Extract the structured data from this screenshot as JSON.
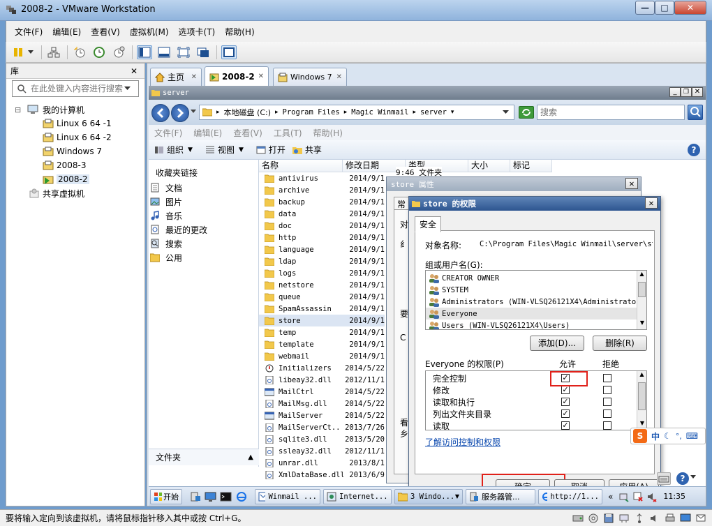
{
  "window": {
    "title": "2008-2 - VMware Workstation",
    "min": "—",
    "max": "□",
    "close": "✕"
  },
  "menu": [
    "文件(F)",
    "编辑(E)",
    "查看(V)",
    "虚拟机(M)",
    "选项卡(T)",
    "帮助(H)"
  ],
  "library": {
    "title": "库",
    "close": "✕",
    "search_placeholder": "在此处键入内容进行搜索",
    "tree": [
      {
        "label": "我的计算机",
        "level": 0,
        "expander": "⊟"
      },
      {
        "label": "Linux 6 64 -1",
        "level": 1
      },
      {
        "label": "Linux 6 64 -2",
        "level": 1
      },
      {
        "label": "Windows 7",
        "level": 1
      },
      {
        "label": "2008-3",
        "level": 1
      },
      {
        "label": "2008-2",
        "level": 1,
        "selected": true
      },
      {
        "label": "共享虚拟机",
        "level": 0,
        "shared": true
      }
    ]
  },
  "tabs": [
    {
      "label": "主页",
      "icon": "home-icon"
    },
    {
      "label": "2008-2",
      "icon": "vm-icon",
      "active": true
    },
    {
      "label": "Windows 7",
      "icon": "vm-icon"
    }
  ],
  "tab_close": "✕",
  "explorer": {
    "title": "server",
    "address": [
      "本地磁盘 (C:)",
      "Program Files",
      "Magic Winmail",
      "server"
    ],
    "search_placeholder": "搜索",
    "menu": [
      "文件(F)",
      "编辑(E)",
      "查看(V)",
      "工具(T)",
      "帮助(H)"
    ],
    "commands": [
      "组织",
      "视图",
      "打开",
      "共享"
    ],
    "nav_title": "收藏夹链接",
    "nav": [
      "文档",
      "图片",
      "音乐",
      "最近的更改",
      "搜索",
      "公用"
    ],
    "folders_label": "文件夹",
    "columns": [
      "名称",
      "修改日期",
      "类型",
      "大小",
      "标记"
    ],
    "files": [
      {
        "name": "antivirus",
        "date": "2014/9/1",
        "type": "folder",
        "extra": "9:46  文件夹"
      },
      {
        "name": "archive",
        "date": "2014/9/1",
        "type": "folder"
      },
      {
        "name": "backup",
        "date": "2014/9/1",
        "type": "folder"
      },
      {
        "name": "data",
        "date": "2014/9/1",
        "type": "folder"
      },
      {
        "name": "doc",
        "date": "2014/9/1",
        "type": "folder"
      },
      {
        "name": "http",
        "date": "2014/9/1",
        "type": "folder"
      },
      {
        "name": "language",
        "date": "2014/9/1",
        "type": "folder"
      },
      {
        "name": "ldap",
        "date": "2014/9/1",
        "type": "folder"
      },
      {
        "name": "logs",
        "date": "2014/9/1",
        "type": "folder"
      },
      {
        "name": "netstore",
        "date": "2014/9/1",
        "type": "folder"
      },
      {
        "name": "queue",
        "date": "2014/9/1",
        "type": "folder"
      },
      {
        "name": "SpamAssassin",
        "date": "2014/9/1",
        "type": "folder"
      },
      {
        "name": "store",
        "date": "2014/9/1",
        "type": "folder",
        "selected": true
      },
      {
        "name": "temp",
        "date": "2014/9/1",
        "type": "folder"
      },
      {
        "name": "template",
        "date": "2014/9/1",
        "type": "folder"
      },
      {
        "name": "webmail",
        "date": "2014/9/1",
        "type": "folder"
      },
      {
        "name": "Initializers",
        "date": "2014/5/22",
        "type": "ini"
      },
      {
        "name": "libeay32.dll",
        "date": "2012/11/1",
        "type": "dll"
      },
      {
        "name": "MailCtrl",
        "date": "2014/5/22",
        "type": "exe"
      },
      {
        "name": "MailMsg.dll",
        "date": "2014/5/22",
        "type": "dll"
      },
      {
        "name": "MailServer",
        "date": "2014/5/22",
        "type": "exe"
      },
      {
        "name": "MailServerCt...",
        "date": "2013/7/26",
        "type": "dll"
      },
      {
        "name": "sqlite3.dll",
        "date": "2013/5/20",
        "type": "dll"
      },
      {
        "name": "ssleay32.dll",
        "date": "2012/11/1",
        "type": "dll"
      },
      {
        "name": "unrar.dll",
        "date": "2013/8/1",
        "type": "dll"
      },
      {
        "name": "XmlDataBase.dll",
        "date": "2013/6/9",
        "type": "dll"
      }
    ]
  },
  "props_dialog": {
    "title": "store 属性",
    "tab_fragment": "常",
    "fragments": [
      "对",
      "纟",
      "要",
      "C",
      "看",
      "乡"
    ]
  },
  "perm_dialog": {
    "title": "store 的权限",
    "tab": "安全",
    "object_label": "对象名称:",
    "object_value": "C:\\Program Files\\Magic Winmail\\server\\st",
    "groups_label": "组或用户名(G):",
    "groups": [
      "CREATOR OWNER",
      "SYSTEM",
      "Administrators (WIN-VLSQ26121X4\\Administrators)",
      "Everyone",
      "Users (WIN-VLSQ26121X4\\Users)"
    ],
    "selected_group": 3,
    "add": "添加(D)...",
    "remove": "删除(R)",
    "perm_label": "Everyone 的权限(P)",
    "allow": "允许",
    "deny": "拒绝",
    "perms": [
      {
        "name": "完全控制",
        "allow": true,
        "deny": false
      },
      {
        "name": "修改",
        "allow": true,
        "deny": false
      },
      {
        "name": "读取和执行",
        "allow": true,
        "deny": false
      },
      {
        "name": "列出文件夹目录",
        "allow": true,
        "deny": false
      },
      {
        "name": "读取",
        "allow": true,
        "deny": false
      }
    ],
    "link": "了解访问控制和权限",
    "ok": "确定",
    "cancel": "取消",
    "apply": "应用(A)",
    "check": "✓"
  },
  "taskbar": {
    "start": "开始",
    "items": [
      "Winmail ...",
      "Internet...",
      "3 Windo...",
      "服务器管...",
      "http://1..."
    ],
    "clock": "11:35",
    "more": "«"
  },
  "ime": {
    "label": "中",
    "icons": [
      "☾",
      "°,",
      "⌨"
    ]
  },
  "status": "要将输入定向到该虚拟机，请将鼠标指针移入其中或按 Ctrl+G。",
  "colors": {
    "highlight": "#e0211a",
    "selection": "#cde3f9",
    "titlebar": "#2d5590"
  }
}
